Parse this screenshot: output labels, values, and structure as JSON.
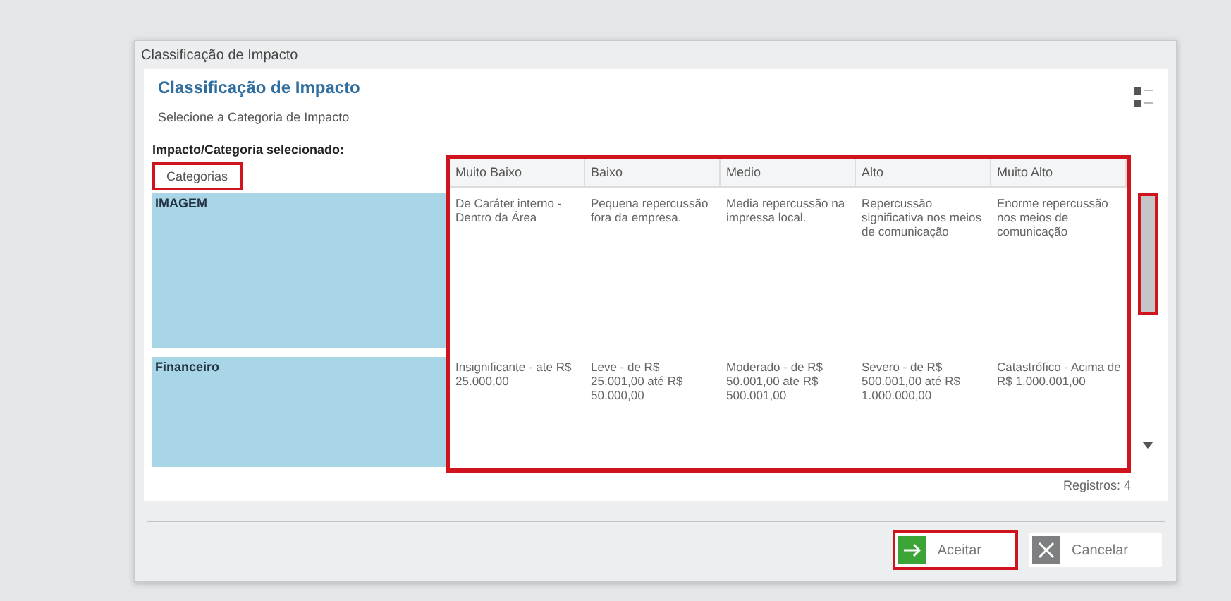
{
  "window": {
    "title": "Classificação de Impacto"
  },
  "header": {
    "title": "Classificação de Impacto",
    "subtitle": "Selecione a Categoria de Impacto"
  },
  "section_label": "Impacto/Categoria selecionado:",
  "table": {
    "category_column": {
      "label": "Categorias",
      "highlighted": true
    },
    "levels_highlighted": true,
    "columns": [
      "Muito Baixo",
      "Baixo",
      "Medio",
      "Alto",
      "Muito Alto"
    ],
    "rows": [
      {
        "category": "IMAGEM",
        "selected": true,
        "cells": [
          "De Caráter interno - Dentro da Área",
          "Pequena repercussão fora da empresa.",
          "Media repercussão na impressa local.",
          "Repercussão significativa nos meios de comunicação",
          "Enorme repercussão nos meios de comunicação"
        ]
      },
      {
        "category": "Financeiro",
        "selected": true,
        "cells": [
          "Insignificante - ate R$ 25.000,00",
          "Leve - de R$ 25.001,00 até R$ 50.000,00",
          "Moderado - de R$ 50.001,00 ate R$ 500.001,00",
          "Severo - de R$ 500.001,00 até R$ 1.000.000,00",
          "Catastrófico - Acima de R$ 1.000.001,00"
        ]
      }
    ],
    "scrollbar_highlighted": true,
    "records": "Registros: 4"
  },
  "buttons": [
    {
      "kind": "accept",
      "label": "Aceitar",
      "highlighted": true
    },
    {
      "kind": "cancel",
      "label": "Cancelar",
      "highlighted": false
    }
  ]
}
